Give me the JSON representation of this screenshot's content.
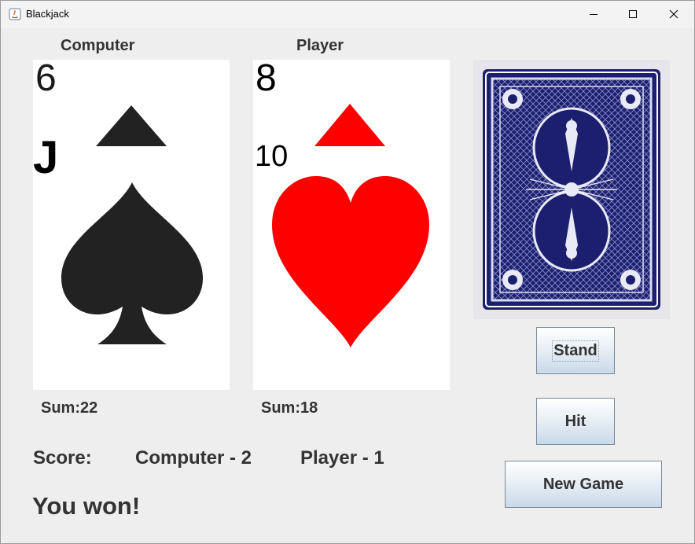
{
  "window": {
    "title": "Blackjack"
  },
  "labels": {
    "computer": "Computer",
    "player": "Player"
  },
  "computer_hand": {
    "cards": [
      {
        "rank": "6",
        "suit": "spades",
        "color": "#222222"
      },
      {
        "rank": "J",
        "suit": "spades",
        "color": "#000000"
      }
    ],
    "sum_text": "Sum:22"
  },
  "player_hand": {
    "cards": [
      {
        "rank": "8",
        "suit": "hearts",
        "color": "#ff0000"
      },
      {
        "rank": "10",
        "suit": "hearts",
        "color": "#ff0000"
      }
    ],
    "sum_text": "Sum:18"
  },
  "score": {
    "label": "Score:",
    "computer": "Computer - 2",
    "player": "Player - 1"
  },
  "result_message": "You won!",
  "buttons": {
    "stand": "Stand",
    "hit": "Hit",
    "new_game": "New Game"
  },
  "colors": {
    "spade": "#222222",
    "heart": "#ff0000",
    "card_back": "#1c1f6e",
    "window_bg": "#eeeeee",
    "text": "#333333"
  },
  "icons": {
    "app": "java-icon",
    "minimize": "minimize-icon",
    "maximize": "maximize-icon",
    "close": "close-icon",
    "deck": "card-back-deck"
  }
}
